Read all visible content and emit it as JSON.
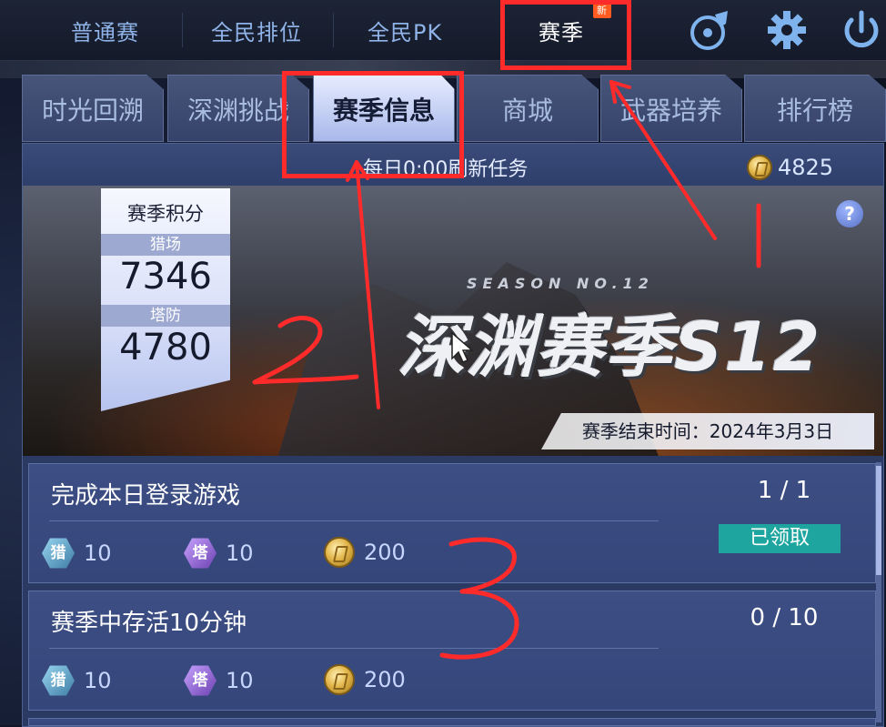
{
  "topnav": {
    "items": [
      {
        "label": "普通赛"
      },
      {
        "label": "全民排位"
      },
      {
        "label": "全民PK"
      },
      {
        "label": "赛季",
        "badge": "新"
      }
    ],
    "icons": [
      "music-disc-icon",
      "gear-icon",
      "power-icon"
    ]
  },
  "tabs": [
    {
      "label": "时光回溯"
    },
    {
      "label": "深渊挑战"
    },
    {
      "label": "赛季信息",
      "active": true
    },
    {
      "label": "商城"
    },
    {
      "label": "武器培养"
    },
    {
      "label": "排行榜"
    }
  ],
  "refresh": {
    "text": "每日0:00刷新任务",
    "coins": "4825"
  },
  "season_score": {
    "title": "赛季积分",
    "hunt_label": "猎场",
    "hunt_value": "7346",
    "tower_label": "塔防",
    "tower_value": "4780"
  },
  "banner": {
    "sub": "SEASON  NO.12",
    "logo": "深渊赛季S12",
    "end_time": "赛季结束时间：2024年3月3日",
    "help": "?"
  },
  "tasks": [
    {
      "title": "完成本日登录游戏",
      "progress": "1 / 1",
      "button": "已领取",
      "rewards": {
        "hunt": "10",
        "tower": "10",
        "coin": "200"
      }
    },
    {
      "title": "赛季中存活10分钟",
      "progress": "0 / 10",
      "rewards": {
        "hunt": "10",
        "tower": "10",
        "coin": "200"
      }
    }
  ],
  "badges": {
    "hunt_glyph": "猎",
    "tower_glyph": "塔"
  },
  "annotations": [
    "1",
    "2",
    "3"
  ],
  "colors": {
    "annotation": "#ff2b2b",
    "claimed": "#1fa5a0",
    "panel": "#2b3a63"
  }
}
